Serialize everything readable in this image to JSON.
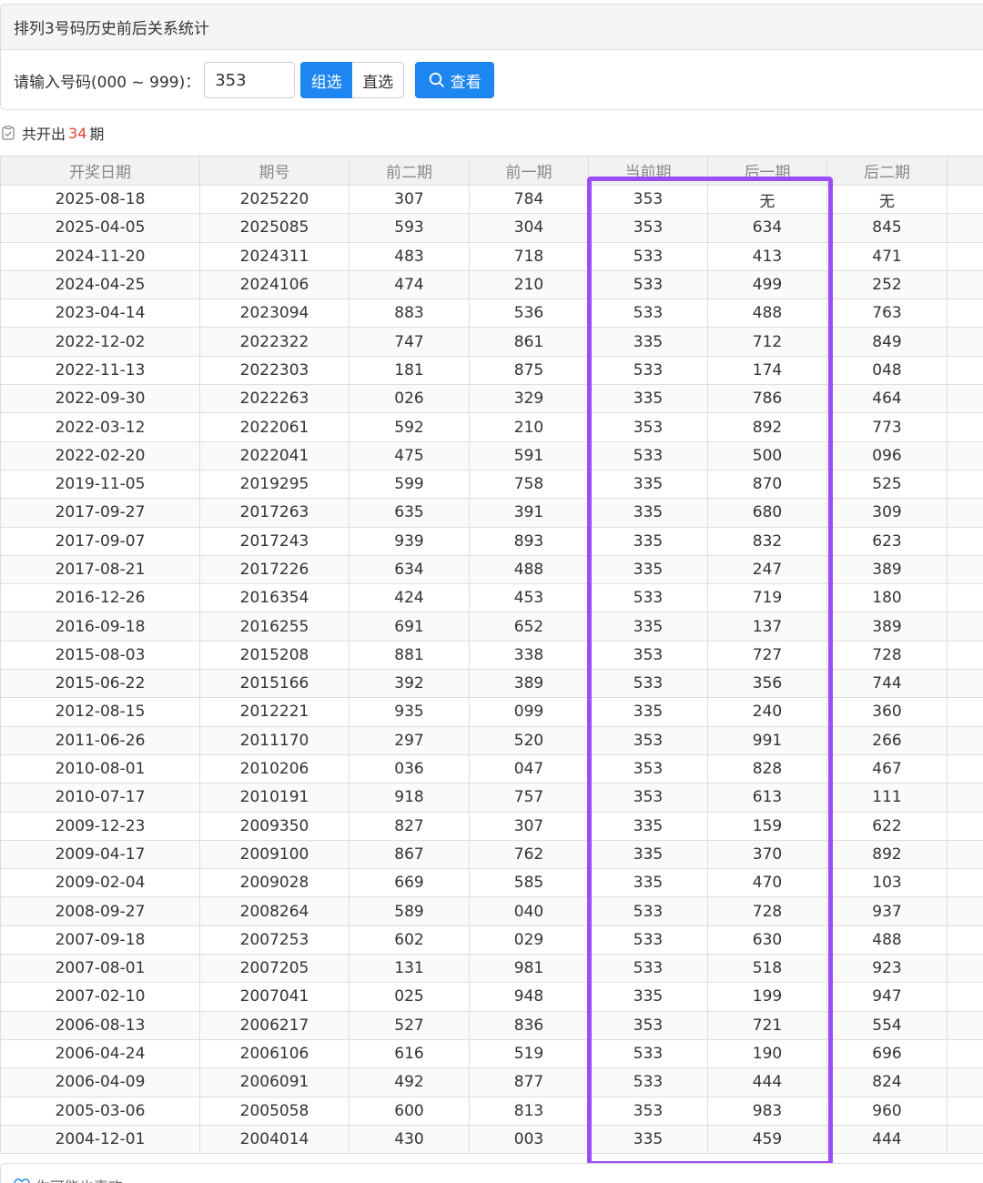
{
  "header": {
    "title": "排列3号码历史前后关系统计"
  },
  "query": {
    "label": "请输入号码(000 ~ 999)：",
    "value": "353",
    "mode_group": "组选",
    "mode_direct": "直选",
    "search_label": "查看"
  },
  "summary": {
    "prefix": "共开出",
    "count": "34",
    "suffix": "期"
  },
  "table": {
    "columns": [
      "开奖日期",
      "期号",
      "前二期",
      "前一期",
      "当前期",
      "后一期",
      "后二期"
    ],
    "rows": [
      [
        "2025-08-18",
        "2025220",
        "307",
        "784",
        "353",
        "无",
        "无"
      ],
      [
        "2025-04-05",
        "2025085",
        "593",
        "304",
        "353",
        "634",
        "845"
      ],
      [
        "2024-11-20",
        "2024311",
        "483",
        "718",
        "533",
        "413",
        "471"
      ],
      [
        "2024-04-25",
        "2024106",
        "474",
        "210",
        "533",
        "499",
        "252"
      ],
      [
        "2023-04-14",
        "2023094",
        "883",
        "536",
        "533",
        "488",
        "763"
      ],
      [
        "2022-12-02",
        "2022322",
        "747",
        "861",
        "335",
        "712",
        "849"
      ],
      [
        "2022-11-13",
        "2022303",
        "181",
        "875",
        "533",
        "174",
        "048"
      ],
      [
        "2022-09-30",
        "2022263",
        "026",
        "329",
        "335",
        "786",
        "464"
      ],
      [
        "2022-03-12",
        "2022061",
        "592",
        "210",
        "353",
        "892",
        "773"
      ],
      [
        "2022-02-20",
        "2022041",
        "475",
        "591",
        "533",
        "500",
        "096"
      ],
      [
        "2019-11-05",
        "2019295",
        "599",
        "758",
        "335",
        "870",
        "525"
      ],
      [
        "2017-09-27",
        "2017263",
        "635",
        "391",
        "335",
        "680",
        "309"
      ],
      [
        "2017-09-07",
        "2017243",
        "939",
        "893",
        "335",
        "832",
        "623"
      ],
      [
        "2017-08-21",
        "2017226",
        "634",
        "488",
        "335",
        "247",
        "389"
      ],
      [
        "2016-12-26",
        "2016354",
        "424",
        "453",
        "533",
        "719",
        "180"
      ],
      [
        "2016-09-18",
        "2016255",
        "691",
        "652",
        "335",
        "137",
        "389"
      ],
      [
        "2015-08-03",
        "2015208",
        "881",
        "338",
        "353",
        "727",
        "728"
      ],
      [
        "2015-06-22",
        "2015166",
        "392",
        "389",
        "533",
        "356",
        "744"
      ],
      [
        "2012-08-15",
        "2012221",
        "935",
        "099",
        "335",
        "240",
        "360"
      ],
      [
        "2011-06-26",
        "2011170",
        "297",
        "520",
        "353",
        "991",
        "266"
      ],
      [
        "2010-08-01",
        "2010206",
        "036",
        "047",
        "353",
        "828",
        "467"
      ],
      [
        "2010-07-17",
        "2010191",
        "918",
        "757",
        "353",
        "613",
        "111"
      ],
      [
        "2009-12-23",
        "2009350",
        "827",
        "307",
        "335",
        "159",
        "622"
      ],
      [
        "2009-04-17",
        "2009100",
        "867",
        "762",
        "335",
        "370",
        "892"
      ],
      [
        "2009-02-04",
        "2009028",
        "669",
        "585",
        "335",
        "470",
        "103"
      ],
      [
        "2008-09-27",
        "2008264",
        "589",
        "040",
        "533",
        "728",
        "937"
      ],
      [
        "2007-09-18",
        "2007253",
        "602",
        "029",
        "533",
        "630",
        "488"
      ],
      [
        "2007-08-01",
        "2007205",
        "131",
        "981",
        "533",
        "518",
        "923"
      ],
      [
        "2007-02-10",
        "2007041",
        "025",
        "948",
        "335",
        "199",
        "947"
      ],
      [
        "2006-08-13",
        "2006217",
        "527",
        "836",
        "353",
        "721",
        "554"
      ],
      [
        "2006-04-24",
        "2006106",
        "616",
        "519",
        "533",
        "190",
        "696"
      ],
      [
        "2006-04-09",
        "2006091",
        "492",
        "877",
        "533",
        "444",
        "824"
      ],
      [
        "2005-03-06",
        "2005058",
        "600",
        "813",
        "353",
        "983",
        "960"
      ],
      [
        "2004-12-01",
        "2004014",
        "430",
        "003",
        "335",
        "459",
        "444"
      ]
    ]
  },
  "footer": {
    "hint": "你可能也喜欢"
  },
  "colors": {
    "accent": "#1e86f0",
    "highlight": "#9b4dfa",
    "count": "#e4432f"
  }
}
